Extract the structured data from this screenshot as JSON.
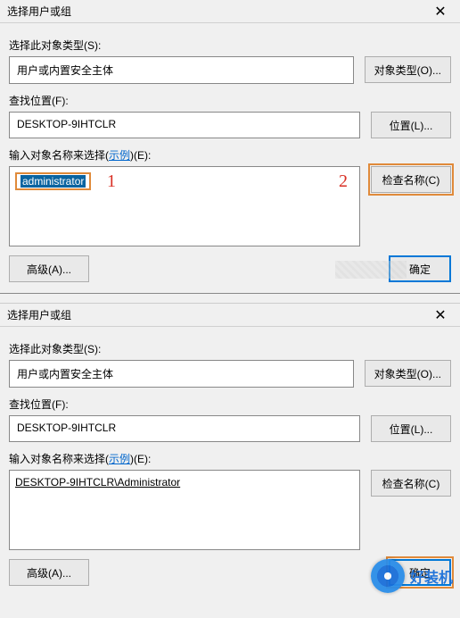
{
  "dialog1": {
    "title": "选择用户或组",
    "close": "✕",
    "object_type_label": "选择此对象类型(S):",
    "object_type_value": "用户或内置安全主体",
    "object_type_button": "对象类型(O)...",
    "location_label": "查找位置(F):",
    "location_value": "DESKTOP-9IHTCLR",
    "location_button": "位置(L)...",
    "names_label_prefix": "输入对象名称来选择(",
    "names_example": "示例",
    "names_label_suffix": ")(E):",
    "names_value": "administrator",
    "check_names_button": "检查名称(C)",
    "advanced_button": "高级(A)...",
    "ok_button": "确定",
    "annot1": "1",
    "annot2": "2"
  },
  "dialog2": {
    "title": "选择用户或组",
    "close": "✕",
    "object_type_label": "选择此对象类型(S):",
    "object_type_value": "用户或内置安全主体",
    "object_type_button": "对象类型(O)...",
    "location_label": "查找位置(F):",
    "location_value": "DESKTOP-9IHTCLR",
    "location_button": "位置(L)...",
    "names_label_prefix": "输入对象名称来选择(",
    "names_example": "示例",
    "names_label_suffix": ")(E):",
    "names_value": "DESKTOP-9IHTCLR\\Administrator",
    "check_names_button": "检查名称(C)",
    "advanced_button": "高级(A)...",
    "ok_button": "确定"
  },
  "watermark_text": "好装机"
}
